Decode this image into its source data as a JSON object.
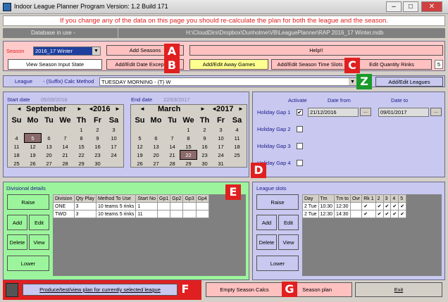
{
  "window": {
    "title": "Indoor League Planner Program Version: 1.2 Build 171",
    "minimize": "–",
    "maximize": "□",
    "close": "✕"
  },
  "warning": "If you change any of the data on this page you should re-calculate the plan for both the league and the season.",
  "database": {
    "label": "Database in use -",
    "path": "H:\\CloudDirs\\Dropbox\\Dunholme\\VB\\LeaguePlanner\\RAP 2016_17 Winter.mdb"
  },
  "season": {
    "label": "Season",
    "value": "2016_17 Winter"
  },
  "buttons": {
    "add_seasons": "Add Seasons",
    "help": "Help!!",
    "view_season_input": "View Season Input State",
    "add_edit_date_exceptions": "Add/Edit Date Exceptions",
    "add_edit_away_games": "Add/Edit Away Games",
    "add_edit_season_time_slots": "Add/Edit Season Time Slots",
    "edit_quantity_rinks": "Edit Quantity Rinks",
    "add_edit_leagues": "Add/Edit Leagues",
    "produce": "Produce/test/view plan for currently selected league",
    "empty_season_calcs": "Empty Season Calcs",
    "season_plan": "Season plan",
    "exit": "Exit"
  },
  "quantity_rinks": "5",
  "league": {
    "label": "League",
    "calc_method_label": "- (Suffix) Calc Method",
    "value": "TUESDAY MORNING - (T) W"
  },
  "badges": {
    "a": "A",
    "b": "B",
    "c": "C",
    "z": "Z",
    "d": "D",
    "e": "E",
    "f": "F",
    "g": "G"
  },
  "start": {
    "label": "Start date",
    "date": "05/09/2016",
    "month": "September",
    "year": "2016",
    "nav_prev_month": "◄",
    "nav_next_month": "►",
    "nav_prev_year": "◄",
    "nav_next_year": "►",
    "days": [
      "Su",
      "Mo",
      "Tu",
      "We",
      "Th",
      "Fr",
      "Sa"
    ],
    "weeks": [
      [
        "",
        "",
        "",
        "",
        "1",
        "2",
        "3"
      ],
      [
        "4",
        "5",
        "6",
        "7",
        "8",
        "9",
        "10"
      ],
      [
        "11",
        "12",
        "13",
        "14",
        "15",
        "16",
        "17"
      ],
      [
        "18",
        "19",
        "20",
        "21",
        "22",
        "23",
        "24"
      ],
      [
        "25",
        "26",
        "27",
        "28",
        "29",
        "30",
        ""
      ]
    ]
  },
  "end": {
    "label": "End date",
    "date": "22/03/2017",
    "month": "March",
    "year": "2017",
    "nav_prev_month": "◄",
    "nav_next_month": "►",
    "nav_prev_year": "◄",
    "nav_next_year": "►",
    "days": [
      "Su",
      "Mo",
      "Tu",
      "We",
      "Th",
      "Fr",
      "Sa"
    ],
    "weeks": [
      [
        "",
        "",
        "",
        "1",
        "2",
        "3",
        "4"
      ],
      [
        "5",
        "6",
        "7",
        "8",
        "9",
        "10",
        "11"
      ],
      [
        "12",
        "13",
        "14",
        "15",
        "16",
        "17",
        "18"
      ],
      [
        "19",
        "20",
        "21",
        "22",
        "23",
        "24",
        "25"
      ],
      [
        "26",
        "27",
        "28",
        "29",
        "30",
        "31",
        ""
      ]
    ]
  },
  "holidays": {
    "headers": {
      "activate": "Activate",
      "from": "Date from",
      "to": "Date to"
    },
    "browse": "...",
    "gaps": [
      {
        "label": "Holiday Gap 1",
        "checked": "✔",
        "from": "21/12/2016",
        "to": "09/01/2017"
      },
      {
        "label": "Holiday Gap 2",
        "checked": "",
        "from": "",
        "to": ""
      },
      {
        "label": "Holiday Gap 3",
        "checked": "",
        "from": "",
        "to": ""
      },
      {
        "label": "Holiday Gap 4",
        "checked": "",
        "from": "",
        "to": ""
      }
    ]
  },
  "divisional": {
    "title": "Divisional details",
    "buttons": {
      "raise": "Raise",
      "add": "Add",
      "edit": "Edit",
      "delete": "Delete",
      "view": "View",
      "lower": "Lower"
    },
    "headers": [
      "Division",
      "Qty Play",
      "Method To Use",
      "Start No",
      "Gp1",
      "Gp2",
      "Gp3",
      "Gp4"
    ],
    "rows": [
      [
        "ONE",
        "3",
        "10 teams 5 rinks",
        "1",
        "",
        "",
        "",
        ""
      ],
      [
        "TWO",
        "3",
        "10 teams 5 rinks",
        "11",
        "",
        "",
        "",
        ""
      ]
    ]
  },
  "slots": {
    "title": "League slots",
    "buttons": {
      "raise": "Raise",
      "add": "Add",
      "edit": "Edit",
      "delete": "Delete",
      "view": "View",
      "lower": "Lower"
    },
    "headers": [
      "Day",
      "Tm",
      "Tm to",
      "Ovr",
      "Rk 1",
      "2",
      "3",
      "4",
      "5"
    ],
    "rows": [
      [
        "2 Tue",
        "10:30",
        "12:30",
        "",
        "✔",
        "✔",
        "✔",
        "✔",
        "✔"
      ],
      [
        "2 Tue",
        "12:30",
        "14:30",
        "",
        "✔",
        "✔",
        "✔",
        "✔",
        "✔"
      ]
    ]
  }
}
